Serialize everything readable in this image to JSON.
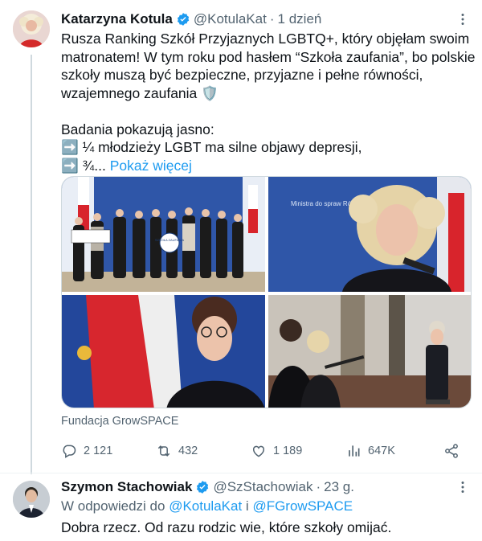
{
  "main_tweet": {
    "author_name": "Katarzyna Kotula",
    "handle": "@KotulaKat",
    "separator": "·",
    "time": "1 dzień",
    "text_lines": [
      "Rusza Ranking Szkół Przyjaznych LGBTQ+, który objęłam swoim",
      "matronatem! W tym roku pod hasłem “Szkoła zaufania”, bo polskie",
      "szkoły muszą być bezpieczne, przyjazne i pełne równości,",
      "wzajemnego zaufania 🛡️",
      "",
      "Badania pokazują jasno:",
      "➡️ ¼ młodzieży LGBT ma silne objawy depresji,"
    ],
    "last_line_prefix": "➡️ ¾...",
    "show_more": "Pokaż więcej",
    "media_source": "Fundacja GrowSPACE",
    "image_texts": {
      "banner_sign": "SZKOŁA ZAUFANIA",
      "podium_text": "Ministra do spraw Równości"
    },
    "stats": {
      "replies": "2 121",
      "retweets": "432",
      "likes": "1 189",
      "views": "647K"
    }
  },
  "reply_tweet": {
    "author_name": "Szymon Stachowiak",
    "handle": "@SzStachowiak",
    "separator": "·",
    "time": "23 g.",
    "reply_prefix": "W odpowiedzi do",
    "reply_user_1": "@KotulaKat",
    "reply_conj": "i",
    "reply_user_2": "@FGrowSPACE",
    "text": "Dobra rzecz. Od razu rodzic wie, które szkoły omijać."
  },
  "colors": {
    "accent": "#1d9bf0",
    "text": "#0f1419",
    "secondary": "#536471",
    "verified": "#1d9bf0"
  }
}
